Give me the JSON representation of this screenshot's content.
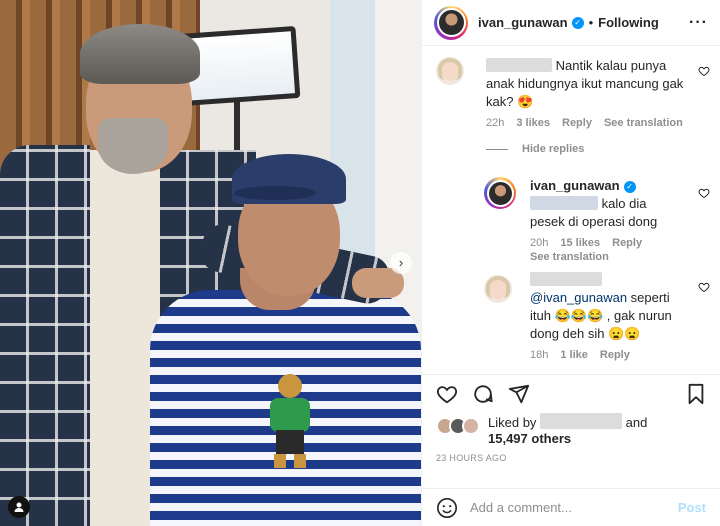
{
  "post": {
    "author": "ivan_gunawan",
    "follow_state": "Following",
    "separator": "•",
    "more_icon": "more-icon"
  },
  "comments": [
    {
      "text": "Nantik kalau punya anak hidungnya ikut mancung gak kak? 😍",
      "time": "22h",
      "likes": "3 likes",
      "reply": "Reply",
      "translate": "See translation"
    }
  ],
  "hide_replies": "Hide replies",
  "replies": [
    {
      "username": "ivan_gunawan",
      "text": "kalo dia pesek di operasi dong",
      "time": "20h",
      "likes": "15 likes",
      "reply": "Reply",
      "translate": "See translation"
    },
    {
      "mention": "@ivan_gunawan",
      "text_line1": " seperti ituh 😂😂😂 , gak nurun dong deh sih 😦😦",
      "time": "18h",
      "likes": "1 like",
      "reply": "Reply"
    }
  ],
  "likes": {
    "prefix": "Liked by",
    "and": "and",
    "others": "15,497 others"
  },
  "timestamp": "23 HOURS AGO",
  "composer": {
    "placeholder": "Add a comment...",
    "post_label": "Post"
  },
  "colors": {
    "verified": "#0095f6",
    "secondary_text": "#8e8e8e",
    "post_disabled": "#b2dffc"
  }
}
